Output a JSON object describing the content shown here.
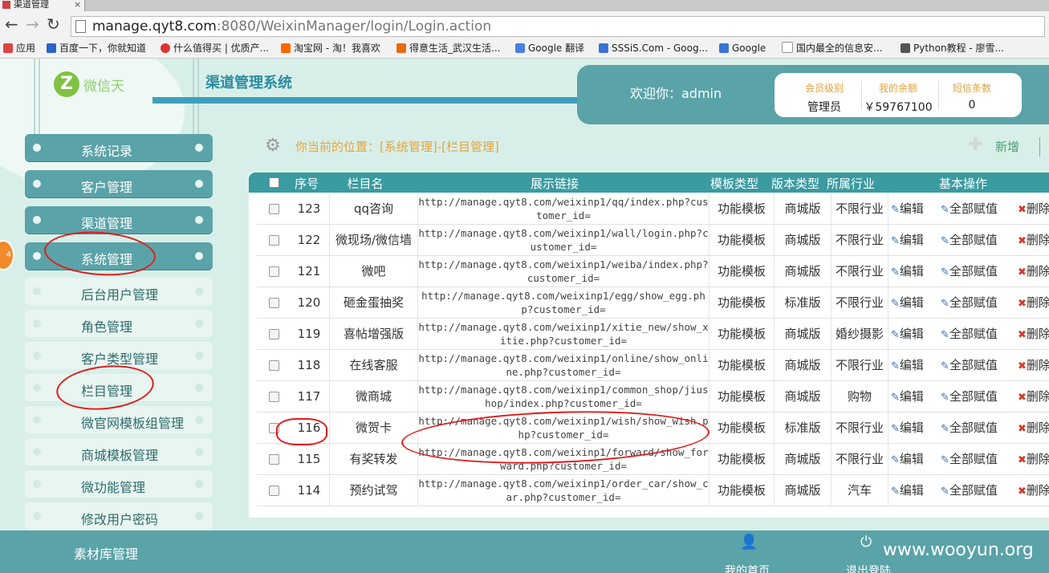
{
  "browser": {
    "tab_title": "渠道管理",
    "url_host": "manage.qyt8.com",
    "url_path": ":8080/WeixinManager/login/Login.action",
    "bookmarks": [
      "应用",
      "百度一下，你就知道",
      "什么值得买 | 优质产...",
      "淘宝网 - 淘！我喜欢",
      "得意生活_武汉生活...",
      "Google 翻译",
      "SSSiS.Com - Goog...",
      "Google",
      "国内最全的信息安...",
      "Python教程 - 廖雪..."
    ]
  },
  "header": {
    "logo_text": "微信天",
    "title": "渠道管理系统",
    "welcome": "欢迎你：admin",
    "stats": [
      {
        "label": "会员级别",
        "value": "管理员"
      },
      {
        "label": "我的余额",
        "value": "￥59767100"
      },
      {
        "label": "短信条数",
        "value": "0"
      }
    ]
  },
  "sidebar": {
    "badge": "4",
    "main_items": [
      "系统记录",
      "客户管理",
      "渠道管理",
      "系统管理"
    ],
    "sub_items": [
      "后台用户管理",
      "角色管理",
      "客户类型管理",
      "栏目管理",
      "微官网模板组管理",
      "商城模板管理",
      "微功能管理",
      "修改用户密码"
    ]
  },
  "toolbar": {
    "location": "你当前的位置：[系统管理]-[栏目管理]",
    "add_label": "新增"
  },
  "table": {
    "headers": [
      "序号",
      "栏目名",
      "展示链接",
      "模板类型",
      "版本类型",
      "所属行业",
      "基本操作"
    ],
    "ops": {
      "edit": "编辑",
      "assign": "全部赋值",
      "delete": "删除"
    },
    "rows": [
      {
        "id": "123",
        "name": "qq咨询",
        "link": "http://manage.qyt8.com/weixinp1/qq/index.php?customer_id=",
        "tpl": "功能模板",
        "ver": "商城版",
        "ind": "不限行业"
      },
      {
        "id": "122",
        "name": "微现场/微信墙",
        "link": "http://manage.qyt8.com/weixinp1/wall/login.php?customer_id=",
        "tpl": "功能模板",
        "ver": "商城版",
        "ind": "不限行业"
      },
      {
        "id": "121",
        "name": "微吧",
        "link": "http://manage.qyt8.com/weixinp1/weiba/index.php?customer_id=",
        "tpl": "功能模板",
        "ver": "商城版",
        "ind": "不限行业"
      },
      {
        "id": "120",
        "name": "砸金蛋抽奖",
        "link": "http://manage.qyt8.com/weixinp1/egg/show_egg.php?customer_id=",
        "tpl": "功能模板",
        "ver": "标准版",
        "ind": "不限行业"
      },
      {
        "id": "119",
        "name": "喜帖增强版",
        "link": "http://manage.qyt8.com/weixinp1/xitie_new/show_xitie.php?customer_id=",
        "tpl": "功能模板",
        "ver": "商城版",
        "ind": "婚纱摄影"
      },
      {
        "id": "118",
        "name": "在线客服",
        "link": "http://manage.qyt8.com/weixinp1/online/show_online.php?customer_id=",
        "tpl": "功能模板",
        "ver": "商城版",
        "ind": "不限行业"
      },
      {
        "id": "117",
        "name": "微商城",
        "link": "http://manage.qyt8.com/weixinp1/common_shop/jiushop/index.php?customer_id=",
        "tpl": "功能模板",
        "ver": "商城版",
        "ind": "购物"
      },
      {
        "id": "116",
        "name": "微贺卡",
        "link": "http://manage.qyt8.com/weixinp1/wish/show_wish.php?customer_id=",
        "tpl": "功能模板",
        "ver": "标准版",
        "ind": "不限行业"
      },
      {
        "id": "115",
        "name": "有奖转发",
        "link": "http://manage.qyt8.com/weixinp1/forward/show_forward.php?customer_id=",
        "tpl": "功能模板",
        "ver": "商城版",
        "ind": "不限行业"
      },
      {
        "id": "114",
        "name": "预约试驾",
        "link": "http://manage.qyt8.com/weixinp1/order_car/show_car.php?customer_id=",
        "tpl": "功能模板",
        "ver": "商城版",
        "ind": "汽车"
      }
    ]
  },
  "footer": {
    "left": "素材库管理",
    "home": "我的首页",
    "logout": "退出登陆",
    "watermark": "www.wooyun.org"
  }
}
